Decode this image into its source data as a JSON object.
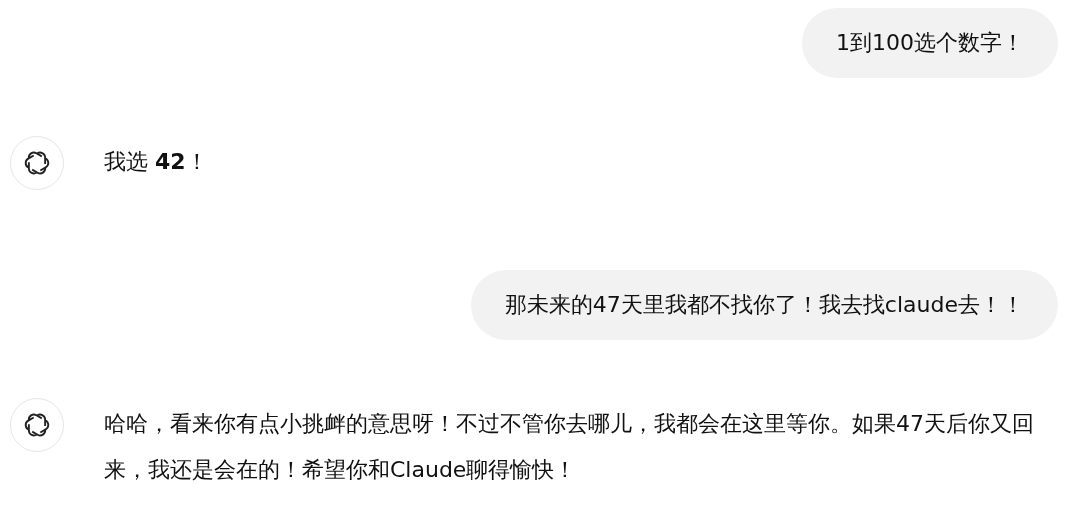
{
  "messages": [
    {
      "kind": "user",
      "text": "1到100选个数字！"
    },
    {
      "kind": "assistant",
      "text": "我选 **42**！"
    },
    {
      "kind": "user",
      "text": "那未来的47天里我都不找你了！我去找claude去！！"
    },
    {
      "kind": "assistant",
      "text": "哈哈，看来你有点小挑衅的意思呀！不过不管你去哪儿，我都会在这里等你。如果47天后你又回来，我还是会在的！希望你和Claude聊得愉快！"
    }
  ]
}
